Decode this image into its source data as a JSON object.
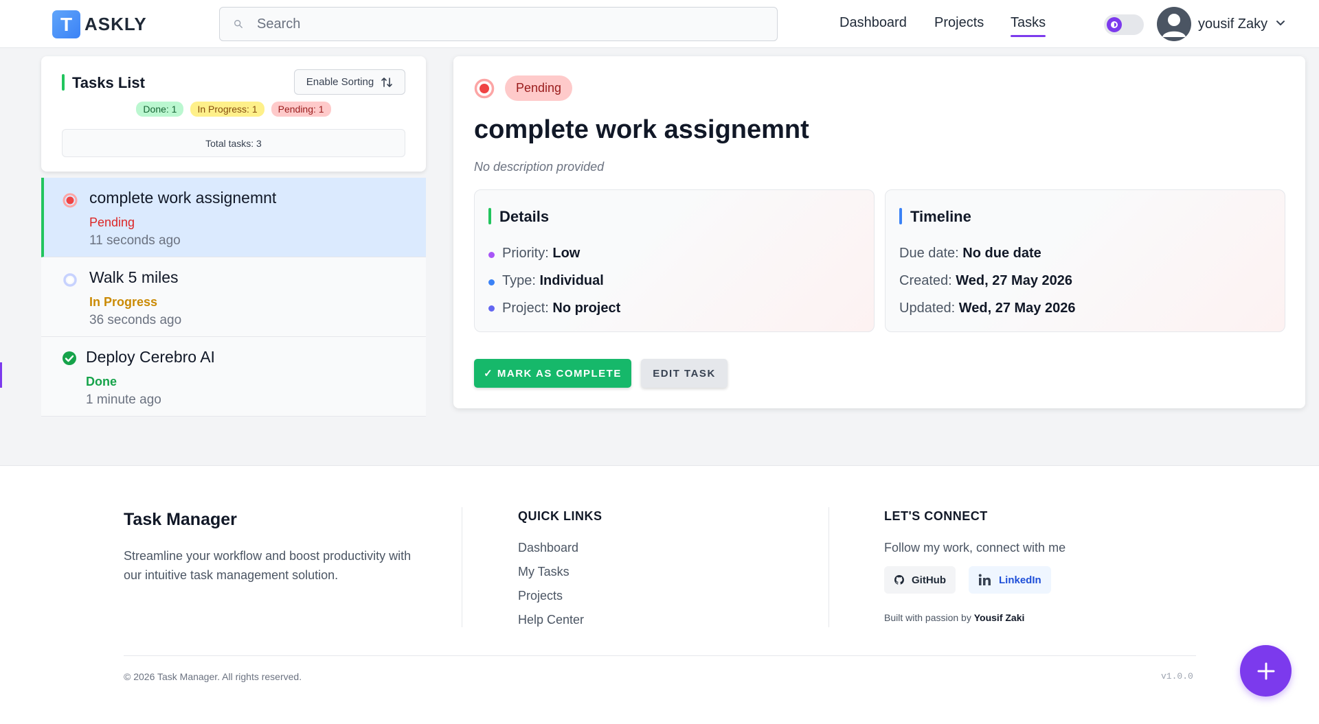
{
  "header": {
    "logo_letter": "T",
    "logo_text": "ASKLY",
    "search_placeholder": "Search",
    "nav": [
      {
        "label": "Dashboard"
      },
      {
        "label": "Projects"
      },
      {
        "label": "Tasks",
        "active": true
      }
    ],
    "theme_toggle": "dark-mode-toggle",
    "user_name": "yousif Zaky"
  },
  "task_list": {
    "title": "Tasks List",
    "sort_label": "Enable Sorting",
    "counts": {
      "done": "Done: 1",
      "in_progress": "In Progress: 1",
      "pending": "Pending: 1"
    },
    "total": "Total tasks: 3",
    "items": [
      {
        "title": "complete work assignemnt",
        "status": "Pending",
        "time": "11 seconds ago",
        "icon": "pending-circle-icon",
        "active": true
      },
      {
        "title": "Walk 5 miles",
        "status": "In Progress",
        "time": "36 seconds ago",
        "icon": "in-progress-circle-icon"
      },
      {
        "title": "Deploy Cerebro AI",
        "status": "Done",
        "time": "1 minute ago",
        "icon": "check-circle-icon"
      }
    ]
  },
  "detail": {
    "status_badge": "Pending",
    "title": "complete work assignemnt",
    "description": "No description provided",
    "details": {
      "heading": "Details",
      "priority_label": "Priority:",
      "priority_value": "Low",
      "type_label": "Type:",
      "type_value": "Individual",
      "project_label": "Project:",
      "project_value": "No project"
    },
    "timeline": {
      "heading": "Timeline",
      "due_label": "Due date:",
      "due_value": "No due date",
      "created_label": "Created:",
      "created_value": "Wed, 27 May 2026",
      "updated_label": "Updated:",
      "updated_value": "Wed, 27 May 2026"
    },
    "complete_button": "✓ MARK AS COMPLETE",
    "edit_button": "EDIT TASK"
  },
  "footer": {
    "brand": "Task Manager",
    "tagline": "Streamline your workflow and boost productivity with our intuitive task management solution.",
    "quick_links_heading": "QUICK LINKS",
    "quick_links": [
      "Dashboard",
      "My Tasks",
      "Projects",
      "Help Center"
    ],
    "connect_heading": "LET'S CONNECT",
    "connect_text": "Follow my work, connect with me",
    "github_label": "GitHub",
    "linkedin_label": "LinkedIn",
    "built_text": "Built with passion by",
    "built_author": "Yousif Zaki",
    "copyright": "© 2026 Task Manager. All rights reserved.",
    "version": "v1.0.0"
  },
  "colors": {
    "accent": "#7c3aed",
    "success": "#16b86a",
    "pending": "#dc2626",
    "in_progress": "#ca8a04"
  }
}
